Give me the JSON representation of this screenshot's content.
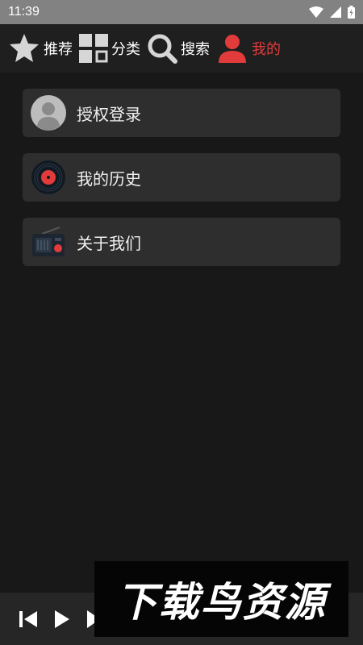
{
  "status_bar": {
    "time": "11:39"
  },
  "nav": {
    "items": [
      {
        "label": "推荐",
        "icon": "star-icon",
        "active": false
      },
      {
        "label": "分类",
        "icon": "grid-icon",
        "active": false
      },
      {
        "label": "搜索",
        "icon": "search-icon",
        "active": false
      },
      {
        "label": "我的",
        "icon": "user-icon",
        "active": true
      }
    ]
  },
  "menu": {
    "items": [
      {
        "label": "授权登录",
        "icon": "avatar-icon"
      },
      {
        "label": "我的历史",
        "icon": "vinyl-record-icon"
      },
      {
        "label": "关于我们",
        "icon": "radio-icon"
      }
    ]
  },
  "player": {
    "controls": [
      "previous-icon",
      "play-icon",
      "next-icon"
    ]
  },
  "watermark": {
    "text": "下载鸟资源"
  },
  "colors": {
    "accent": "#e23b3b",
    "background": "#181818",
    "card": "#2e2e2e"
  }
}
